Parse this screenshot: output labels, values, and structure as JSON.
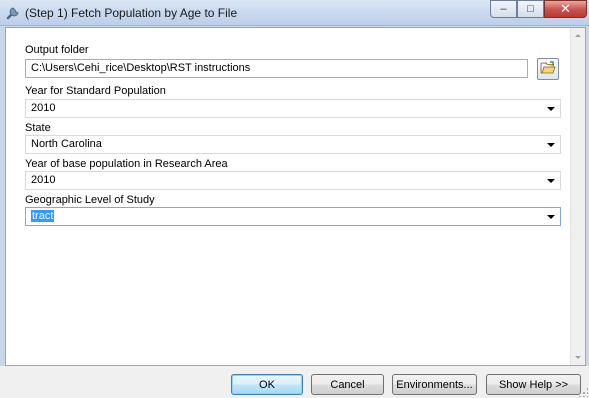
{
  "window": {
    "title": "(Step 1) Fetch Population by Age to File",
    "controls": {
      "minimize": "–",
      "maximize": "□",
      "close": "✕"
    }
  },
  "form": {
    "output_folder": {
      "label": "Output folder",
      "value": "C:\\Users\\Cehi_rice\\Desktop\\RST instructions"
    },
    "year_standard": {
      "label": "Year for Standard Population",
      "value": "2010"
    },
    "state": {
      "label": "State",
      "value": "North Carolina"
    },
    "year_base": {
      "label": "Year of base population in Research Area",
      "value": "2010"
    },
    "geographic_level": {
      "label": "Geographic Level of Study",
      "value": "tract"
    }
  },
  "buttons": {
    "ok": "OK",
    "cancel": "Cancel",
    "environments": "Environments...",
    "show_help": "Show Help >>"
  },
  "icons": {
    "app": "arcgis-tool-icon",
    "browse": "open-folder-icon"
  },
  "colors": {
    "selection": "#3399ff",
    "titlebar": "#c9d9ee",
    "close_button": "#c75050"
  }
}
